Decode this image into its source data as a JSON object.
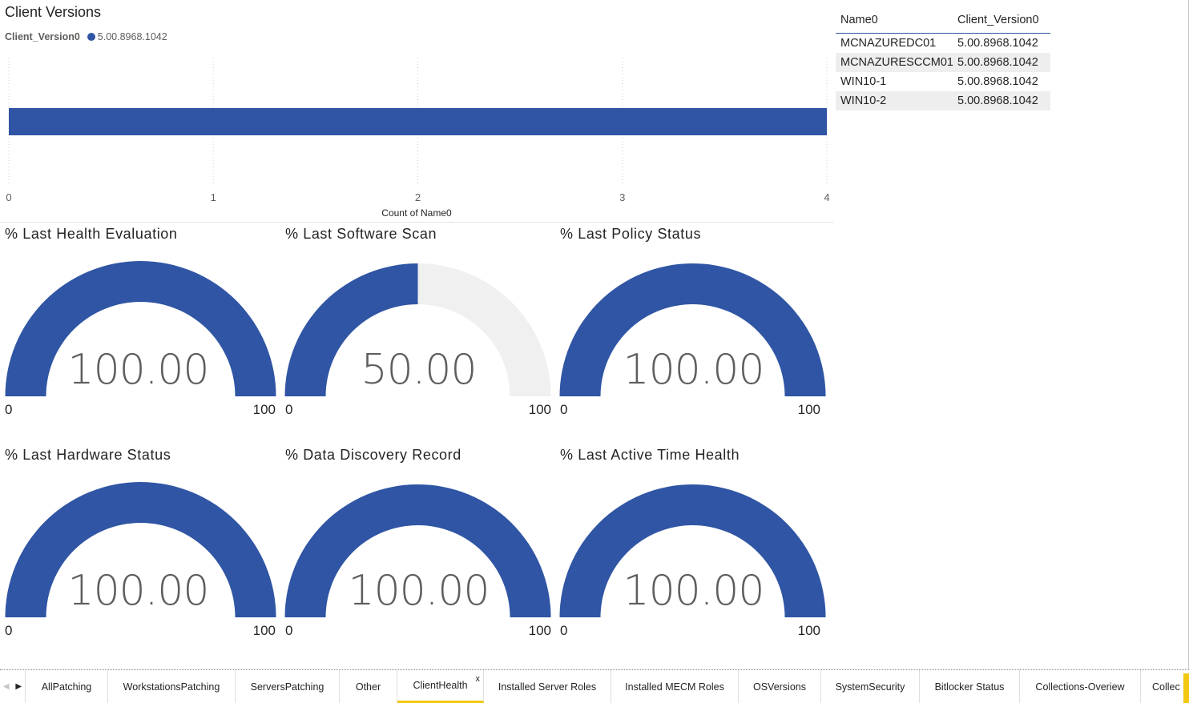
{
  "bar_chart": {
    "title": "Client Versions",
    "legend_title": "Client_Version0",
    "legend_item": "5.00.8968.1042",
    "x_axis_title": "Count of Name0",
    "color": "#2f55a4"
  },
  "chart_data": {
    "type": "bar",
    "orientation": "horizontal",
    "categories": [
      "5.00.8968.1042"
    ],
    "values": [
      4
    ],
    "title": "Client Versions",
    "xlabel": "Count of Name0",
    "ylabel": "",
    "xlim": [
      0,
      4
    ],
    "xticks": [
      "0",
      "1",
      "2",
      "3",
      "4"
    ],
    "grid": true,
    "legend": "top-left"
  },
  "table": {
    "headers": [
      "Name0",
      "Client_Version0"
    ],
    "rows": [
      [
        "MCNAZUREDC01",
        "5.00.8968.1042"
      ],
      [
        "MCNAZURESCCM01",
        "5.00.8968.1042"
      ],
      [
        "WIN10-1",
        "5.00.8968.1042"
      ],
      [
        "WIN10-2",
        "5.00.8968.1042"
      ]
    ]
  },
  "gauges": [
    {
      "title": "% Last Health Evaluation",
      "value": "100.00",
      "fraction": 1.0,
      "min": "0",
      "max": "100"
    },
    {
      "title": "% Last Software Scan",
      "value": "50.00",
      "fraction": 0.5,
      "min": "0",
      "max": "100"
    },
    {
      "title": "% Last Policy Status",
      "value": "100.00",
      "fraction": 1.0,
      "min": "0",
      "max": "100"
    },
    {
      "title": "% Last Hardware Status",
      "value": "100.00",
      "fraction": 1.0,
      "min": "0",
      "max": "100"
    },
    {
      "title": "% Data Discovery Record",
      "value": "100.00",
      "fraction": 1.0,
      "min": "0",
      "max": "100"
    },
    {
      "title": "% Last Active Time Health",
      "value": "100.00",
      "fraction": 1.0,
      "min": "0",
      "max": "100"
    }
  ],
  "colors": {
    "accent": "#2f55a4",
    "gauge_track": "#f0f0f0",
    "active_tab": "#f2c811"
  },
  "tabs": [
    {
      "label": "AllPatching"
    },
    {
      "label": "WorkstationsPatching"
    },
    {
      "label": "ServersPatching"
    },
    {
      "label": "Other"
    },
    {
      "label": "ClientHealth",
      "active": true,
      "close": "x"
    },
    {
      "label": "Installed Server Roles"
    },
    {
      "label": "Installed MECM Roles"
    },
    {
      "label": "OSVersions"
    },
    {
      "label": "SystemSecurity"
    },
    {
      "label": "Bitlocker Status"
    },
    {
      "label": "Collections-Overiew"
    },
    {
      "label": "Collec"
    }
  ],
  "icons": {
    "prev": "chevron-left-icon",
    "next": "chevron-right-icon"
  }
}
